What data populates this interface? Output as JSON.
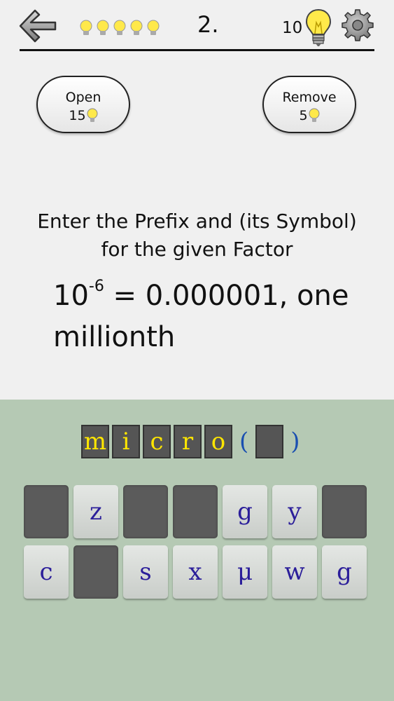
{
  "header": {
    "level": "2.",
    "hint_count": "10",
    "progress_bulbs": 5
  },
  "buttons": {
    "open": {
      "label": "Open",
      "cost": "15"
    },
    "remove": {
      "label": "Remove",
      "cost": "5"
    }
  },
  "question": {
    "instruction_line1": "Enter the Prefix and (its Symbol)",
    "instruction_line2": "for the given Factor",
    "factor_base": "10",
    "factor_exponent": "-6",
    "factor_rest": " = 0.000001, one millionth"
  },
  "answer": {
    "letters": [
      "m",
      "i",
      "c",
      "r",
      "o"
    ],
    "open_paren": "(",
    "close_paren": ")",
    "symbol": ""
  },
  "keyboard": {
    "rows": [
      [
        "",
        "z",
        "",
        "",
        "g",
        "y",
        ""
      ],
      [
        "c",
        "",
        "s",
        "x",
        "μ",
        "w",
        "g"
      ]
    ]
  },
  "colors": {
    "bulb": "#ffe94a",
    "slot_text": "#ffe600",
    "paren": "#1a4fb0",
    "key_text": "#2b1e9a",
    "keyboard_bg": "#b5c9b4"
  }
}
